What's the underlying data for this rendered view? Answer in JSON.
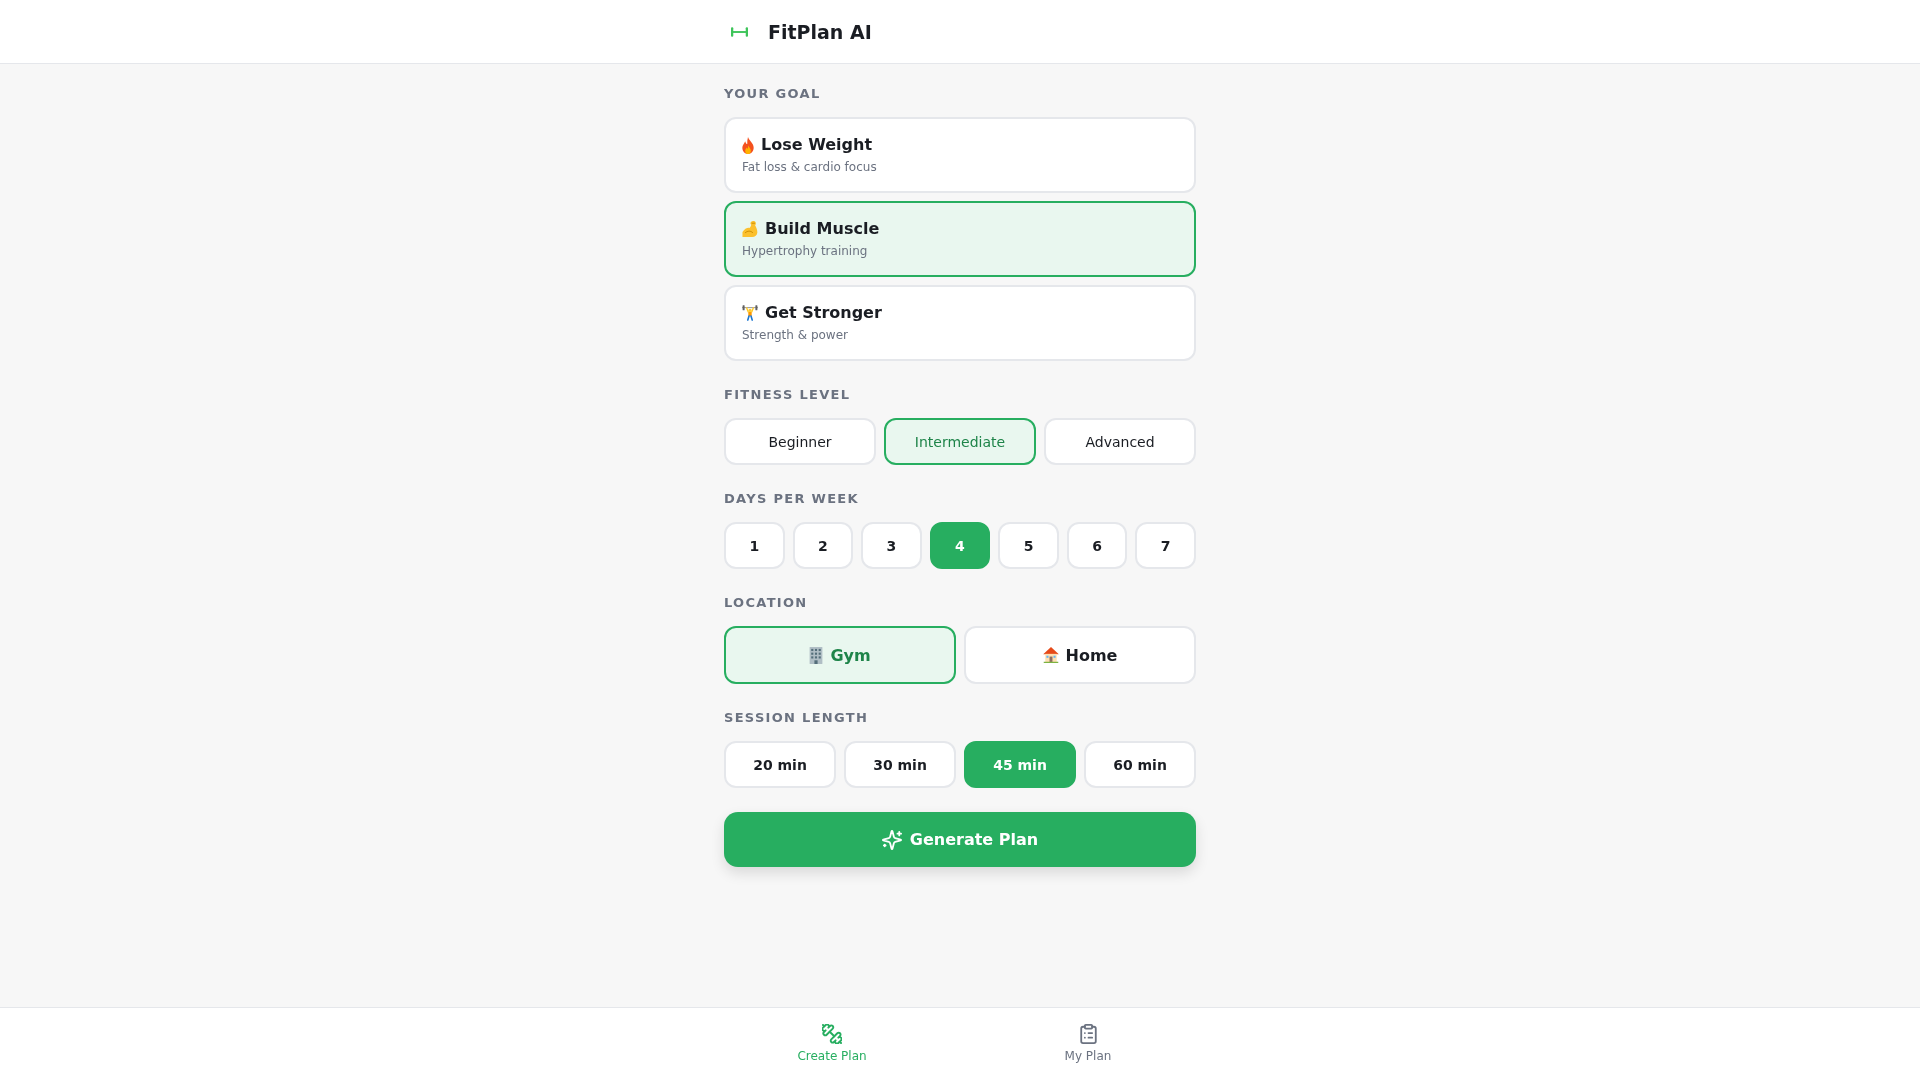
{
  "header": {
    "title": "FitPlan AI"
  },
  "goal": {
    "label": "YOUR GOAL",
    "options": [
      {
        "title": "Lose Weight",
        "subtitle": "Fat loss & cardio focus",
        "selected": false
      },
      {
        "title": "Build Muscle",
        "subtitle": "Hypertrophy training",
        "selected": true
      },
      {
        "title": "Get Stronger",
        "subtitle": "Strength & power",
        "selected": false
      }
    ]
  },
  "fitness_level": {
    "label": "FITNESS LEVEL",
    "options": [
      {
        "label": "Beginner",
        "selected": false
      },
      {
        "label": "Intermediate",
        "selected": true
      },
      {
        "label": "Advanced",
        "selected": false
      }
    ]
  },
  "days_per_week": {
    "label": "DAYS PER WEEK",
    "options": [
      {
        "label": "1",
        "selected": false
      },
      {
        "label": "2",
        "selected": false
      },
      {
        "label": "3",
        "selected": false
      },
      {
        "label": "4",
        "selected": true
      },
      {
        "label": "5",
        "selected": false
      },
      {
        "label": "6",
        "selected": false
      },
      {
        "label": "7",
        "selected": false
      }
    ]
  },
  "location": {
    "label": "LOCATION",
    "options": [
      {
        "label": "Gym",
        "selected": true
      },
      {
        "label": "Home",
        "selected": false
      }
    ]
  },
  "session_length": {
    "label": "SESSION LENGTH",
    "options": [
      {
        "label": "20 min",
        "selected": false
      },
      {
        "label": "30 min",
        "selected": false
      },
      {
        "label": "45 min",
        "selected": true
      },
      {
        "label": "60 min",
        "selected": false
      }
    ]
  },
  "generate_button": {
    "label": "Generate Plan"
  },
  "bottom_nav": [
    {
      "label": "Create Plan",
      "selected": true
    },
    {
      "label": "My Plan",
      "selected": false
    }
  ]
}
